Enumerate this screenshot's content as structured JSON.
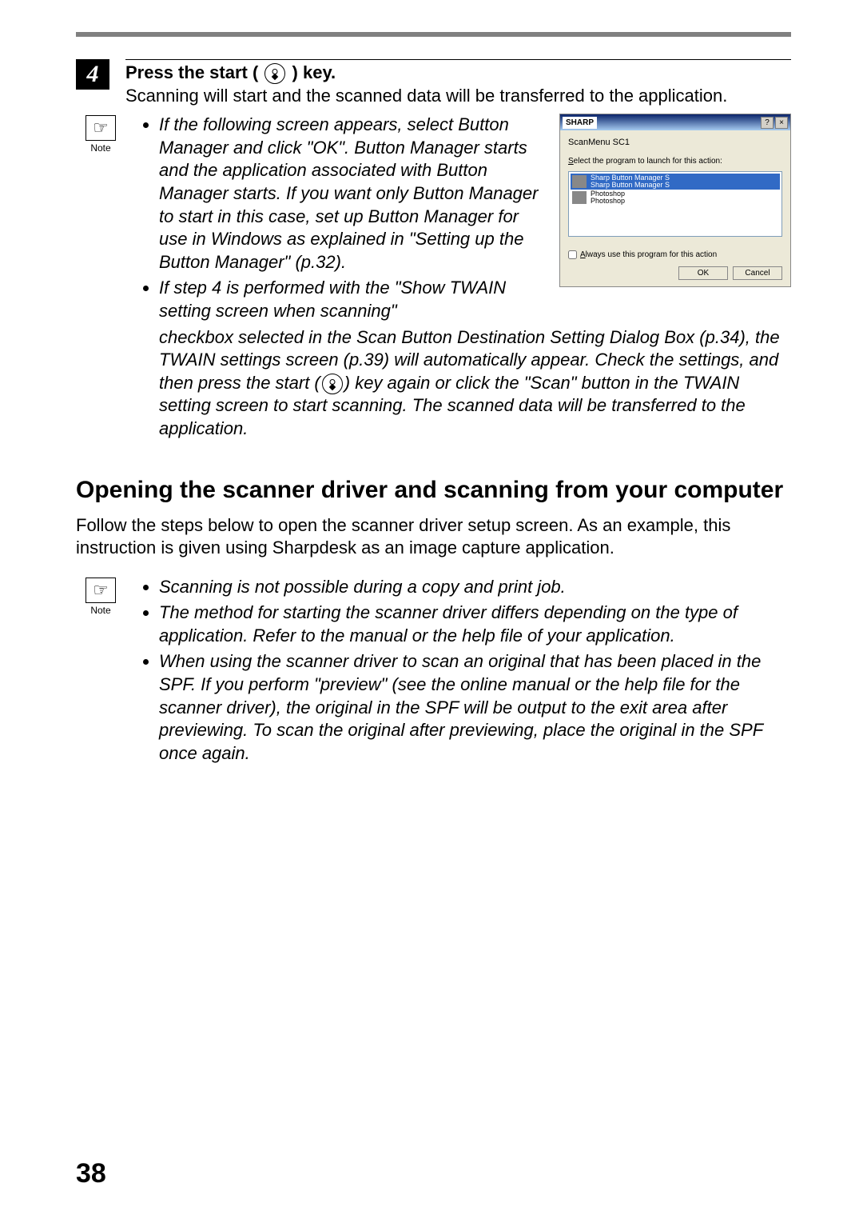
{
  "step": {
    "number": "4",
    "title_prefix": "Press the start (",
    "title_suffix": ") key.",
    "desc": "Scanning will start and the scanned data will be transferred to the application."
  },
  "note1": {
    "label": "Note",
    "bullet1": "If the following screen appears, select Button Manager and click \"OK\". Button Manager starts and the application associated with Button Manager starts. If you want only Button Manager to start in this case, set up Button Manager for use in Windows as explained in \"Setting up the Button Manager\" (p.32).",
    "bullet2_part1": "If step 4 is performed with the \"Show TWAIN setting screen when scanning\" checkbox selected in the Scan Button Destination Setting Dialog Box (p.34), the TWAIN settings screen (p.39) will automatically appear. Check the settings, and then press the start (",
    "bullet2_part2": ") key again or click the \"Scan\" button in the TWAIN setting screen to start scanning. The scanned data will be transferred to the application."
  },
  "dialog": {
    "brand": "SHARP",
    "subtitle": "ScanMenu SC1",
    "prompt": "Select the program to launch for this action:",
    "item1_line1": "Sharp Button Manager S",
    "item1_line2": "Sharp Button Manager S",
    "item2_line1": "Photoshop",
    "item2_line2": "Photoshop",
    "checkbox": "Always use this program for this action",
    "ok": "OK",
    "cancel": "Cancel"
  },
  "section": {
    "heading": "Opening the scanner driver and scanning from your computer",
    "desc": "Follow the steps below to open the scanner driver setup screen. As an example, this instruction is given using Sharpdesk as an image capture application."
  },
  "note2": {
    "label": "Note",
    "bullet1": "Scanning is not possible during a copy and print job.",
    "bullet2": "The method for starting the scanner driver differs depending on the type of application. Refer to the manual or the help file of your application.",
    "bullet3": "When using the scanner driver to scan an original that has been placed in the SPF. If you perform \"preview\" (see the online manual or the help file for the scanner driver), the original in the SPF will be output to the exit area after previewing. To scan the original after previewing, place the original in the SPF once again."
  },
  "page": "38"
}
